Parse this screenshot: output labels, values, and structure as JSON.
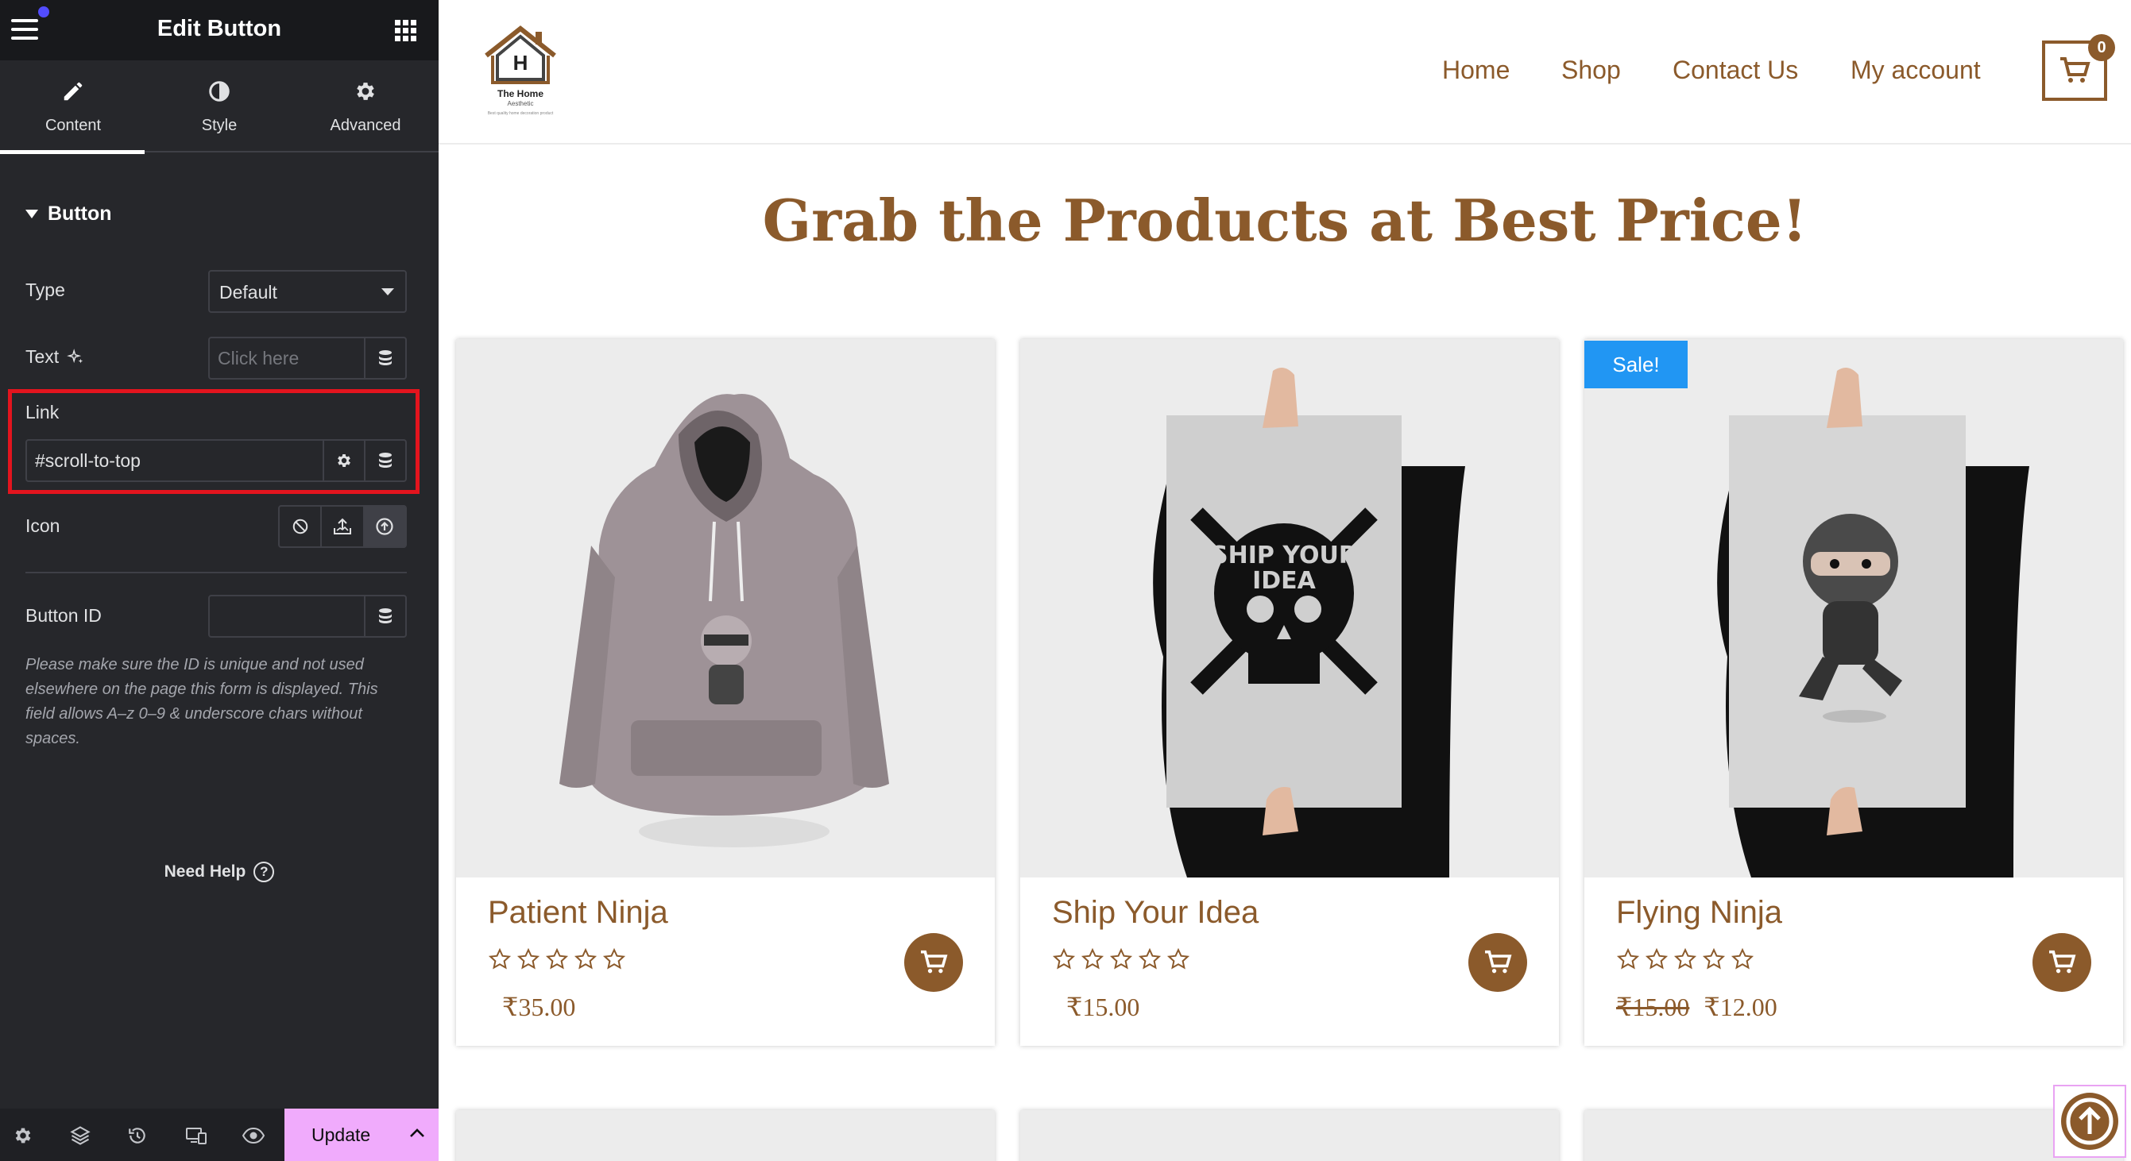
{
  "panel": {
    "title": "Edit Button",
    "tabs": [
      {
        "label": "Content",
        "icon": "pencil-icon"
      },
      {
        "label": "Style",
        "icon": "half-circle-icon"
      },
      {
        "label": "Advanced",
        "icon": "gear-icon"
      }
    ],
    "section_title": "Button",
    "type": {
      "label": "Type",
      "value": "Default"
    },
    "text": {
      "label": "Text",
      "placeholder": "Click here"
    },
    "link": {
      "label": "Link",
      "value": "#scroll-to-top"
    },
    "icon": {
      "label": "Icon"
    },
    "button_id": {
      "label": "Button ID",
      "value": ""
    },
    "help_text": "Please make sure the ID is unique and not used elsewhere on the page this form is displayed. This field allows A–z  0–9 & underscore chars without spaces.",
    "need_help": "Need Help",
    "update_label": "Update",
    "highlight_color": "#e3141e",
    "accent_update": "#f0abfc"
  },
  "site": {
    "logo": {
      "name": "The Home",
      "sub": "Aesthetic",
      "tagline": "Best quality home decoration product",
      "letter": "H"
    },
    "nav": [
      "Home",
      "Shop",
      "Contact Us",
      "My account"
    ],
    "cart_count": "0",
    "heading": "Grab the Products at Best Price!",
    "brand_color": "#8b5a2b",
    "products": [
      {
        "name": "Patient Ninja",
        "price": "₹35.00",
        "old_price": "",
        "sale": ""
      },
      {
        "name": "Ship Your Idea",
        "price": "₹15.00",
        "old_price": "",
        "sale": ""
      },
      {
        "name": "Flying Ninja",
        "price": "₹12.00",
        "old_price": "₹15.00",
        "sale": "Sale!"
      }
    ],
    "poster_text": [
      "SHIP YOUR",
      "IDEA"
    ]
  }
}
